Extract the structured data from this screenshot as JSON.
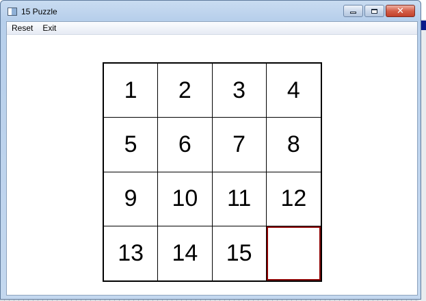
{
  "window": {
    "title": "15 Puzzle",
    "icon": "app-window-icon",
    "caption_buttons": [
      "minimize-icon",
      "maximize-icon",
      "close-icon"
    ]
  },
  "menu": {
    "items": [
      "Reset",
      "Exit"
    ]
  },
  "board": {
    "rows": [
      [
        "1",
        "2",
        "3",
        "4"
      ],
      [
        "5",
        "6",
        "7",
        "8"
      ],
      [
        "9",
        "10",
        "11",
        "12"
      ],
      [
        "13",
        "14",
        "15",
        ""
      ]
    ],
    "empty_highlight_color": "#8b0000"
  }
}
